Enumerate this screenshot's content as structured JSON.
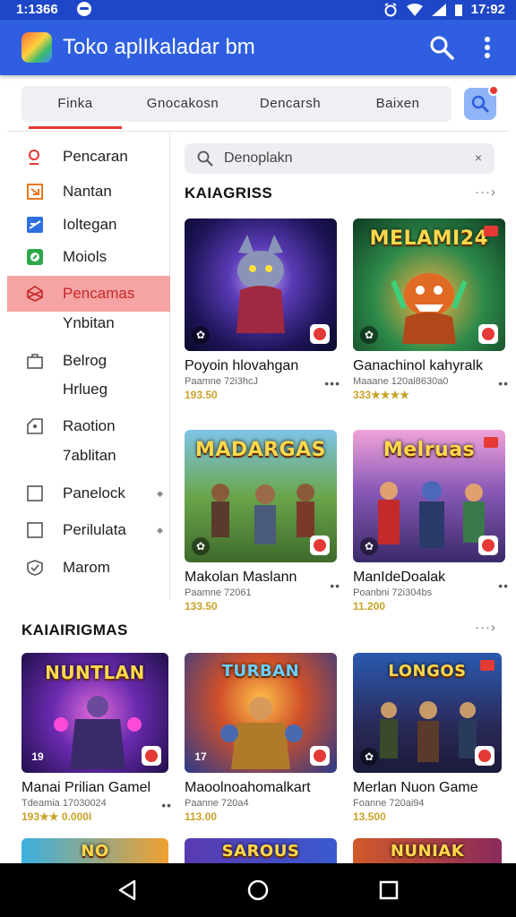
{
  "status": {
    "time": "1:1366",
    "clock": "17:92"
  },
  "app": {
    "title": "Toko aplIkaladar bm"
  },
  "tabs": [
    {
      "label": "Finka"
    },
    {
      "label": "Gnocakosn"
    },
    {
      "label": "Dencarsh"
    },
    {
      "label": "Baixen"
    }
  ],
  "sidebar": {
    "items": [
      {
        "label": "Pencaran",
        "icon": "search-icon"
      },
      {
        "label": "Nantan",
        "icon": "download-icon"
      },
      {
        "label": "Ioltegan",
        "icon": "image-icon"
      },
      {
        "label": "Moiols",
        "icon": "circle-icon"
      },
      {
        "label": "Pencamas",
        "icon": "cube-icon"
      },
      {
        "label": "Ynbitan",
        "icon": ""
      },
      {
        "label": "Belrog",
        "icon": "bag-icon"
      },
      {
        "label": "Hrlueg",
        "icon": ""
      },
      {
        "label": "Raotion",
        "icon": "tag-icon"
      },
      {
        "label": "7ablitan",
        "icon": ""
      },
      {
        "label": "Panelock",
        "icon": "square-icon"
      },
      {
        "label": "Perilulata",
        "icon": "square-icon"
      },
      {
        "label": "Marom",
        "icon": "shield-icon"
      }
    ]
  },
  "search": {
    "placeholder": "Denoplakn",
    "clear": "×"
  },
  "section1": {
    "title": "KAIAGRISS",
    "more": "···›",
    "apps": [
      {
        "name": "Poyoin hlovahgan",
        "sub": "Paamne 72i3hcJ",
        "price": "193.50",
        "banner": ""
      },
      {
        "name": "Ganachinol kahyralk",
        "sub": "Maaane 120ai8630a0",
        "price": "333★★★★",
        "banner": "MELAMI24"
      },
      {
        "name": "Makolan Maslann",
        "sub": "Paamne 72061",
        "price": "133.50",
        "banner": "MADARGAS"
      },
      {
        "name": "ManIdeDoalak",
        "sub": "Poanbni 72i304bs",
        "price": "11.200",
        "banner": "Melruas"
      }
    ]
  },
  "section2": {
    "title": "KAIAIRIGMAS",
    "more": "···›",
    "apps": [
      {
        "name": "Manai Prilian Gamel",
        "sub": "Tdeamia 17030024",
        "price": "193★★ 0.000I",
        "banner": "NUNTLAN"
      },
      {
        "name": "Maoolnoahomalkart",
        "sub": "Paanne 720a4",
        "price": "113.00",
        "banner": "TURBAN"
      },
      {
        "name": "Merlan Nuon Game",
        "sub": "Foanne 720ai94",
        "price": "13.500",
        "banner": "LONGOS"
      }
    ]
  },
  "section3": {
    "banners": [
      "NO",
      "SAROUS",
      "NUNIAK"
    ]
  },
  "colors": {
    "primary": "#2f5fe0",
    "accent": "#e53935",
    "status": "#1e46c8",
    "highlight": "#f5a3a3"
  }
}
